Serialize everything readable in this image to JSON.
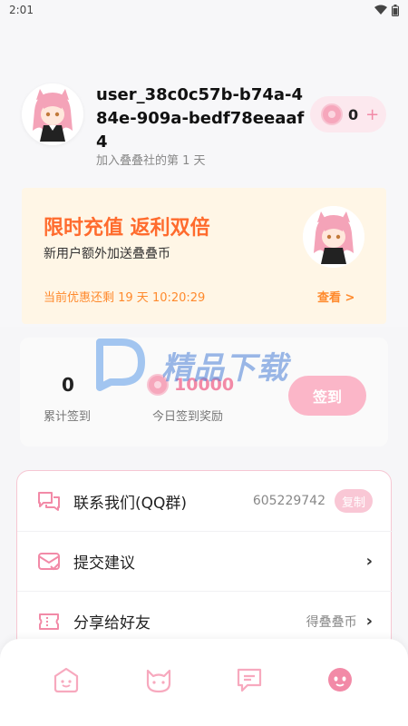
{
  "status_bar": {
    "time": "2:01",
    "icons": [
      "wifi-icon",
      "battery-icon"
    ]
  },
  "profile": {
    "username": "user_38c0c57b-b74a-484e-909a-bedf78eeaaf4",
    "coin_count": "0",
    "coin_plus": "+",
    "join_text": "加入叠叠社的第 1 天"
  },
  "promo": {
    "title": "限时充值 返利双倍",
    "subtitle": "新用户额外加送叠叠币",
    "countdown": "当前优惠还剩 19 天 10:20:29",
    "view_label": "查看 >"
  },
  "signin": {
    "count": "0",
    "count_label": "累计签到",
    "reward_value": "10000",
    "reward_label": "今日签到奖励",
    "button_label": "签到"
  },
  "watermark": {
    "text": "精品下载"
  },
  "menu": {
    "items": [
      {
        "label": "联系我们(QQ群)",
        "value": "605229742",
        "action": "复制",
        "icon": "chat-bubbles-icon"
      },
      {
        "label": "提交建议",
        "value": "",
        "icon": "mail-check-icon"
      },
      {
        "label": "分享给好友",
        "value": "得叠叠币",
        "icon": "ticket-icon"
      }
    ]
  },
  "bottom_nav": {
    "items": [
      {
        "icon": "home-face-icon",
        "active": false
      },
      {
        "icon": "cat-face-icon",
        "active": false
      },
      {
        "icon": "message-icon",
        "active": false
      },
      {
        "icon": "profile-face-icon",
        "active": true
      }
    ]
  },
  "colors": {
    "accent_pink": "#f28aa7",
    "promo_orange": "#ff6b2d",
    "promo_bg": "#fff6e6",
    "sign_button": "#fbb6c8"
  }
}
